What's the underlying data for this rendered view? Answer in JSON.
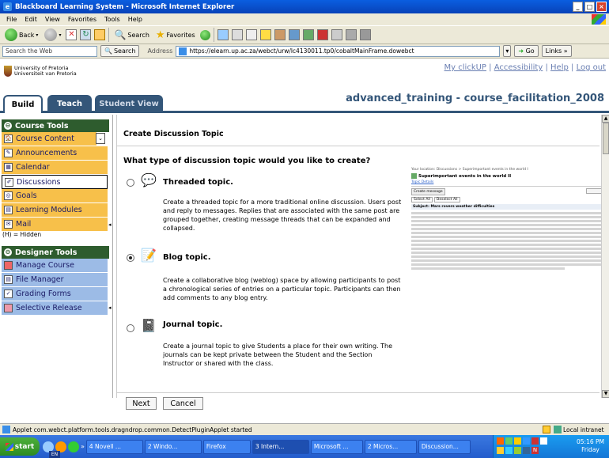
{
  "window": {
    "title": "Blackboard Learning System - Microsoft Internet Explorer",
    "min": "_",
    "max": "□",
    "close": "×"
  },
  "menu": [
    "File",
    "Edit",
    "View",
    "Favorites",
    "Tools",
    "Help"
  ],
  "toolbar": {
    "back": "Back",
    "search": "Search",
    "favorites": "Favorites"
  },
  "addressbar": {
    "search_web_label": "Search the Web",
    "search_btn": "Search",
    "address_label": "Address",
    "url": "https://elearn.up.ac.za/webct/urw/lc4130011.tp0/cobaltMainFrame.dowebct",
    "go": "Go",
    "links": "Links"
  },
  "header": {
    "university_en": "University of Pretoria",
    "university_af": "Universiteit van Pretoria",
    "links": [
      "My clickUP",
      "Accessibility",
      "Help",
      "Log out"
    ],
    "separator": "|",
    "course_title": "advanced_training - course_facilitation_2008"
  },
  "tabs": [
    "Build",
    "Teach",
    "Student View"
  ],
  "nav": {
    "course_tools": "Course Tools",
    "course_items": [
      "Course Content",
      "Announcements",
      "Calendar",
      "Discussions",
      "Goals",
      "Learning Modules",
      "Mail"
    ],
    "hidden_legend": "(H) = Hidden",
    "designer_tools": "Designer Tools",
    "designer_items": [
      "Manage Course",
      "File Manager",
      "Grading Forms",
      "Selective Release"
    ]
  },
  "main": {
    "page_title": "Create Discussion Topic",
    "question": "What type of discussion topic would you like to create?",
    "options": [
      {
        "label": "Threaded topic.",
        "desc": "Create a threaded topic for a more traditional online discussion. Users post and reply to messages. Replies that are associated with the same post are grouped together, creating message threads that can be expanded and collapsed.",
        "selected": false
      },
      {
        "label": "Blog topic.",
        "desc": "Create a collaborative blog (weblog) space by allowing participants to post a chronological series of entries on a particular topic. Participants can then add comments to any blog entry.",
        "selected": true
      },
      {
        "label": "Journal topic.",
        "desc": "Create a journal topic to give Students a place for their own writing. The journals can be kept private between the Student and the Section Instructor or shared with the class.",
        "selected": false
      }
    ],
    "next": "Next",
    "cancel": "Cancel"
  },
  "preview": {
    "location": "Your location: Discussions > Superimportant events in the world I",
    "heading": "Superimportant events in the world II",
    "topic_details": "Topic Details",
    "create_message": "Create message",
    "select_all": "Select All",
    "deselect_all": "Deselect All",
    "subject": "Subject: Mars rovers weather difficulties"
  },
  "status": {
    "text": "Applet com.webct.platform.tools.dragndrop.common.DetectPluginApplet started",
    "zone": "Local intranet"
  },
  "taskbar": {
    "start": "start",
    "tasks": [
      "4 Novell ...",
      "2 Windo...",
      "Firefox",
      "3 Intern...",
      "Microsoft ...",
      "2 Micros...",
      "Discussion..."
    ],
    "time": "05:16 PM",
    "day": "Friday",
    "lang": "EN"
  }
}
